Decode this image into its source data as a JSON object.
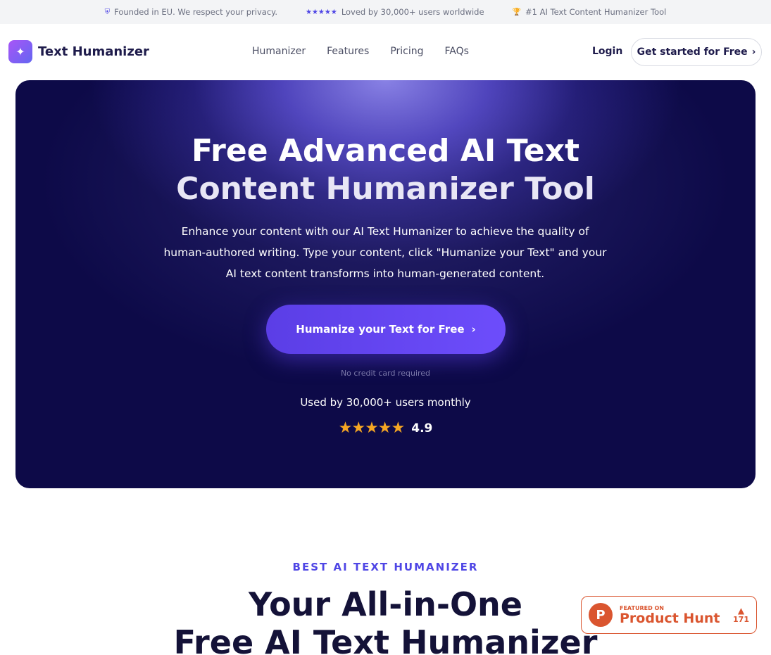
{
  "topbar": {
    "items": [
      {
        "icon": "shield-icon",
        "text": "Founded in EU. We respect your privacy."
      },
      {
        "icon": "stars-icon",
        "text": "Loved by 30,000+ users worldwide"
      },
      {
        "icon": "trophy-icon",
        "text": "#1 AI Text Content Humanizer Tool"
      }
    ]
  },
  "nav": {
    "brand": "Text Humanizer",
    "links": [
      "Humanizer",
      "Features",
      "Pricing",
      "FAQs"
    ],
    "login": "Login",
    "cta": "Get started for Free"
  },
  "hero": {
    "title_line1": "Free Advanced AI Text",
    "title_line2": "Content Humanizer Tool",
    "subtitle": "Enhance your content with our AI Text Humanizer to achieve the quality of human-authored writing. Type your content, click \"Humanize your Text\" and your AI text content transforms into human-generated content.",
    "cta": "Humanize your Text for Free",
    "note": "No credit card required",
    "used_by": "Used by 30,000+ users monthly",
    "rating_stars": 5,
    "rating": "4.9"
  },
  "section": {
    "eyebrow": "BEST AI TEXT HUMANIZER",
    "title_line1": "Your All-in-One",
    "title_line2": "Free AI Text Humanizer"
  },
  "product_hunt": {
    "small": "FEATURED ON",
    "big": "Product Hunt",
    "votes": "171"
  },
  "colors": {
    "accent": "#4f46e5",
    "hero_dark": "#0d0a48",
    "star": "#f5a623",
    "product_hunt": "#da552f"
  }
}
